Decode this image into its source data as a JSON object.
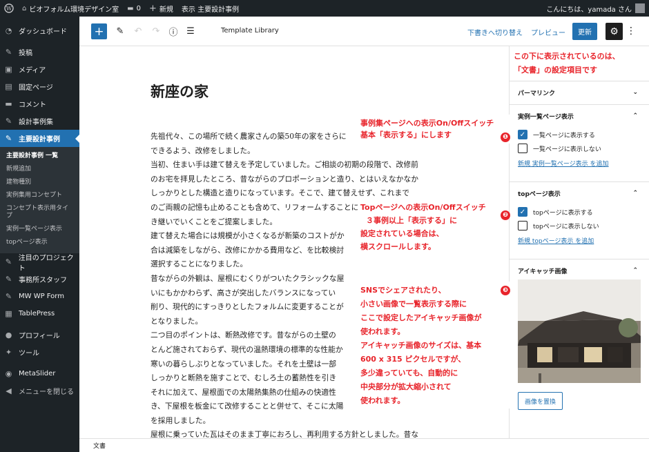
{
  "adminbar": {
    "site_name": "ビオフォルム環境デザイン室",
    "comments_count": "0",
    "new_label": "新規",
    "view_label": "表示 主要設計事例",
    "greeting": "こんにちは、yamada さん"
  },
  "sidebar": {
    "items": [
      {
        "label": "ダッシュボード",
        "icon": "dashboard-icon"
      },
      {
        "label": "投稿",
        "icon": "pin-icon"
      },
      {
        "label": "メディア",
        "icon": "media-icon"
      },
      {
        "label": "固定ページ",
        "icon": "page-icon"
      },
      {
        "label": "コメント",
        "icon": "comment-icon"
      },
      {
        "label": "設計事例集",
        "icon": "pin-icon"
      },
      {
        "label": "主要設計事例",
        "icon": "pin-icon"
      }
    ],
    "submenu": [
      "主要設計事例 一覧",
      "新規追加",
      "建物種別",
      "実例集用コンセプト",
      "コンセプト表示用タイプ",
      "実例一覧ページ表示",
      "topページ表示"
    ],
    "items2": [
      {
        "label": "注目のプロジェクト",
        "icon": "pin-icon"
      },
      {
        "label": "事務所スタッフ",
        "icon": "pin-icon"
      },
      {
        "label": "MW WP Form",
        "icon": "pin-icon"
      },
      {
        "label": "TablePress",
        "icon": "table-icon"
      },
      {
        "label": "プロフィール",
        "icon": "user-icon"
      },
      {
        "label": "ツール",
        "icon": "wrench-icon"
      },
      {
        "label": "MetaSlider",
        "icon": "slider-icon"
      },
      {
        "label": "メニューを閉じる",
        "icon": "collapse-icon"
      }
    ]
  },
  "toolbar": {
    "template_library": "Template Library",
    "switch_draft": "下書きへ切り替え",
    "preview": "プレビュー",
    "update": "更新"
  },
  "editor": {
    "title": "新座の家",
    "lines": [
      "先祖代々、この場所で続く農家さんの築50年の家をさらに",
      "できるよう、改修をしました。",
      "当初、住まい手は建て替えを予定していました。ご相談の初期の段階で、改修前",
      "のお宅を拝見したところ、昔ながらのプロポーションと造り、とはいえなかなか",
      "しっかりとした構造と造りになっています。そこで、建て替えせず、これまで",
      "のご両親の記憶も止めることも含めて、リフォームすることに",
      "き継いでいくことをご提案しました。",
      "建て替えた場合には規模が小さくなるが新築のコストがか",
      "合は減築をしながら、改修にかかる費用など、を比較検討",
      "選択することになりました。",
      "昔ながらの外観は、屋根にむくりがついたクラシックな屋",
      "いにもかかわらず、高さが突出したバランスになってい",
      "削り、現代的にすっきりとしたフォルムに変更することが",
      "となりました。",
      "二つ目のポイントは、断熱改修です。昔ながらの土壁の",
      "とんど施されておらず、現代の温熱環境の標準的な性能か",
      "寒いの暮らしぶりとなっていました。それを土壁は一部",
      "しっかりと断熱を施すことで、むしろ土の蓄熱性を引き",
      "それに加えて、屋根面での太陽熱集熱の仕組みの快適性",
      "き、下屋根を板金にて改修することと併せて、そこに太陽",
      "を採用しました。",
      "屋根に乗っていた瓦はそのまま丁寧におろし、再利用する方針としました。昔な"
    ],
    "status": "文書"
  },
  "settings": {
    "permalink": "パーマリンク",
    "list_panel": {
      "title": "実例一覧ページ表示",
      "options": [
        {
          "label": "一覧ページに表示する",
          "checked": true
        },
        {
          "label": "一覧ページに表示しない",
          "checked": false
        }
      ],
      "add": "新規 実例一覧ページ表示 を追加"
    },
    "top_panel": {
      "title": "topページ表示",
      "options": [
        {
          "label": "topページに表示する",
          "checked": true
        },
        {
          "label": "topページに表示しない",
          "checked": false
        }
      ],
      "add": "新規 topページ表示 を追加"
    },
    "eyecatch": {
      "title": "アイキャッチ画像",
      "replace": "画像を置換"
    }
  },
  "annotations": {
    "settings_note": [
      "この下に表示されているのは、",
      "「文書」の設定項目です"
    ],
    "note1": [
      "事例集ページへの表示On/Offスイッチ",
      "基本「表示する」にします"
    ],
    "note2": [
      "Topページへの表示On/Offスイッチ",
      "３事例以上「表示する」に",
      "設定されている場合は、",
      "横スクロールします。"
    ],
    "note3": [
      "SNSでシェアされたり、",
      "小さい画像で一覧表示する際に",
      "ここで設定したアイキャッチ画像が",
      "使われます。",
      "アイキャッチ画像のサイズは、基本",
      "600 x 315 ピクセルですが、",
      "多少違っていても、自動的に",
      "中央部分が拡大縮小されて",
      "使われます。"
    ],
    "num1": "❶",
    "num2": "❷",
    "num3": "❸",
    "accent": "#e8242b"
  }
}
